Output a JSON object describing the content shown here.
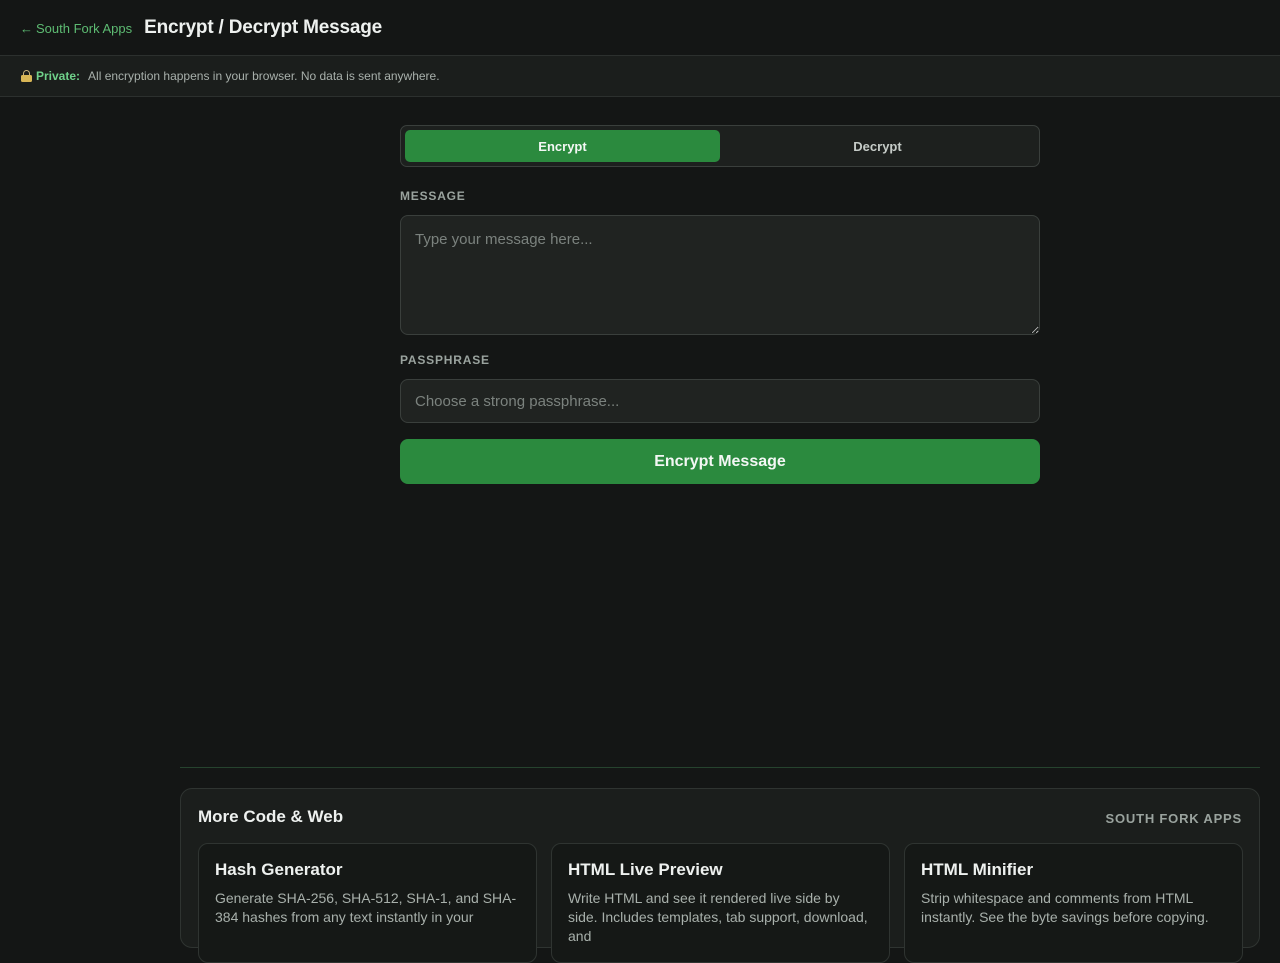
{
  "header": {
    "back_link": "South Fork Apps",
    "back_arrow": "←",
    "title": "Encrypt / Decrypt Message"
  },
  "privacy": {
    "label": "Private:",
    "text": "All encryption happens in your browser. No data is sent anywhere."
  },
  "mode_toggle": {
    "encrypt_label": "Encrypt",
    "decrypt_label": "Decrypt",
    "active": "Encrypt"
  },
  "message": {
    "label": "MESSAGE",
    "placeholder": "Type your message here...",
    "value": ""
  },
  "passphrase": {
    "label": "PASSPHRASE",
    "placeholder": "Choose a strong passphrase...",
    "value": ""
  },
  "submit": {
    "label": "Encrypt Message"
  },
  "more": {
    "title": "More Code & Web",
    "brand": "SOUTH FORK APPS",
    "cards": [
      {
        "title": "Hash Generator",
        "desc": "Generate SHA-256, SHA-512, SHA-1, and SHA-384 hashes from any text instantly in your"
      },
      {
        "title": "HTML Live Preview",
        "desc": "Write HTML and see it rendered live side by side. Includes templates, tab support, download, and"
      },
      {
        "title": "HTML Minifier",
        "desc": "Strip whitespace and comments from HTML instantly. See the byte savings before copying."
      }
    ]
  },
  "colors": {
    "accent": "#2b8a3e",
    "link": "#5dbb72",
    "background": "#141615"
  }
}
